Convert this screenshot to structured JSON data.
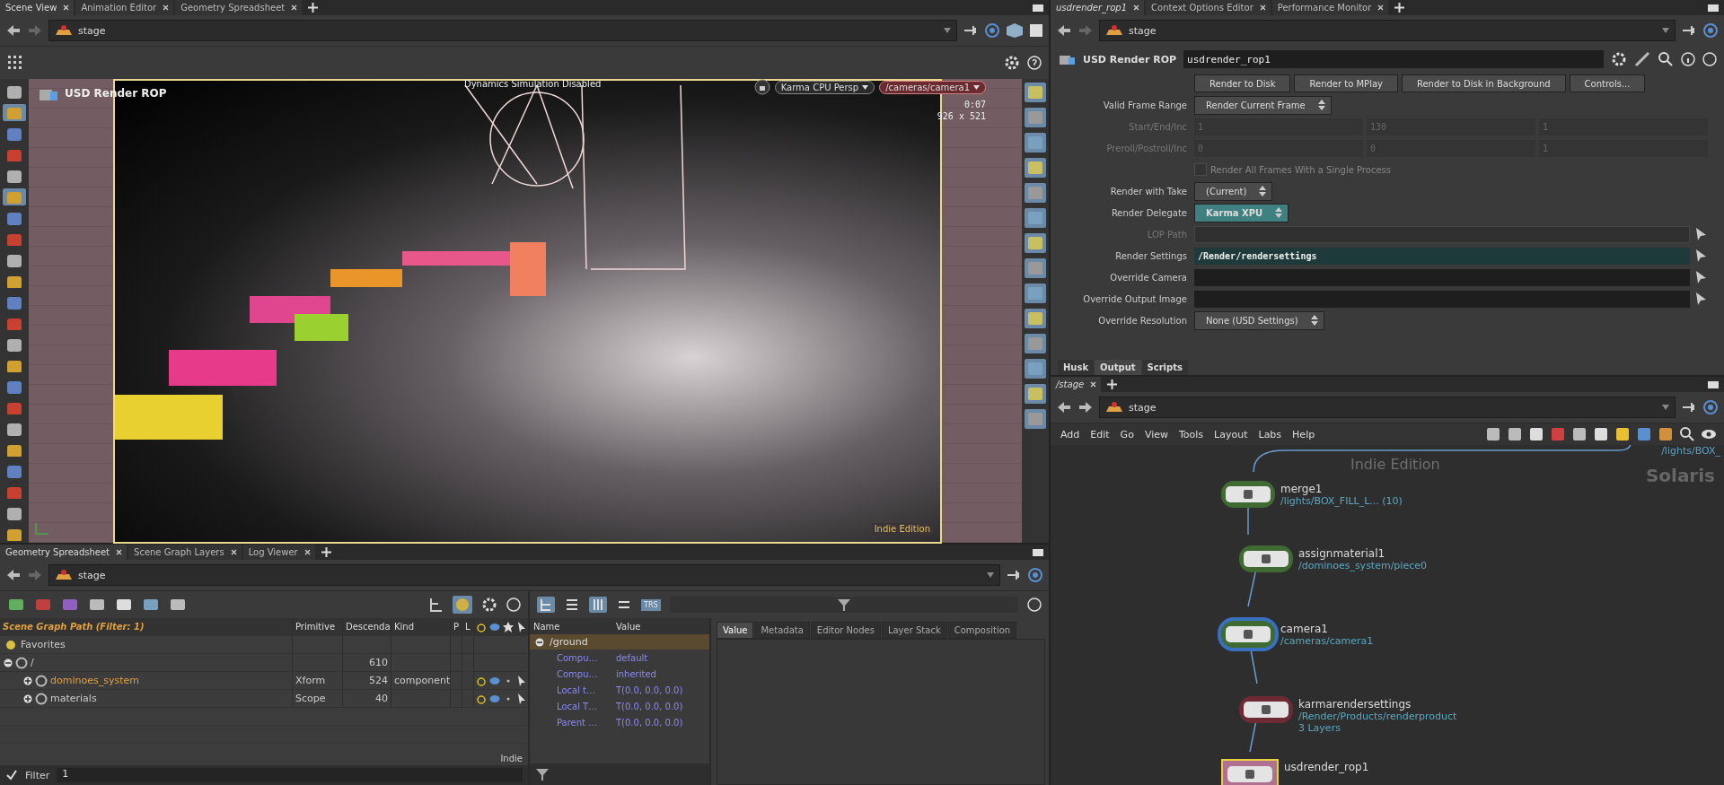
{
  "scene_view": {
    "tabs": [
      {
        "label": "Scene View",
        "selected": true
      },
      {
        "label": "Animation Editor",
        "selected": false
      },
      {
        "label": "Geometry Spreadsheet",
        "selected": false
      }
    ],
    "path": "stage",
    "viewport": {
      "node_label": "USD Render ROP",
      "status": "Dynamics Simulation Disabled",
      "renderer": "Karma CPU  Persp",
      "camera": "/cameras/camera1",
      "time": "0:07",
      "resolution": "926 x 521",
      "edition": "Indie Edition"
    }
  },
  "spreadsheet": {
    "tabs": [
      {
        "label": "Geometry Spreadsheet",
        "selected": true
      },
      {
        "label": "Scene Graph Layers",
        "selected": false
      },
      {
        "label": "Log Viewer",
        "selected": false
      }
    ],
    "path": "stage",
    "tree_columns": [
      "Scene Graph Path  (Filter: 1)",
      "Primitive",
      "Descenda",
      "Kind",
      "P",
      "L"
    ],
    "tree": [
      {
        "kind": "favorites",
        "name": "Favorites"
      },
      {
        "kind": "prim",
        "name": "/",
        "expanded": true,
        "highlighted": false,
        "descendants": "610",
        "children": [
          {
            "kind": "prim",
            "name": "dominoes_system",
            "expanded": false,
            "highlighted": true,
            "primitive": "Xform",
            "descendants": "524",
            "prim_kind": "component"
          },
          {
            "kind": "prim",
            "name": "materials",
            "expanded": false,
            "highlighted": false,
            "primitive": "Scope",
            "descendants": "40"
          }
        ]
      }
    ],
    "edition": "Indie",
    "filter_label": "Filter",
    "filter_value": "1",
    "attr_columns": [
      "Name",
      "Value"
    ],
    "attr_prim": "/ground",
    "attributes": [
      {
        "name": "Compu…",
        "value": "default"
      },
      {
        "name": "Compu…",
        "value": "inherited"
      },
      {
        "name": "Local t…",
        "value": "T(0.0, 0.0, 0.0)"
      },
      {
        "name": "Local T…",
        "value": "T(0.0, 0.0, 0.0)"
      },
      {
        "name": "Parent …",
        "value": "T(0.0, 0.0, 0.0)"
      }
    ],
    "trs_label": "TRS",
    "detail_tabs": [
      {
        "label": "Value",
        "selected": true
      },
      {
        "label": "Metadata",
        "selected": false
      },
      {
        "label": "Editor Nodes",
        "selected": false
      },
      {
        "label": "Layer Stack",
        "selected": false
      },
      {
        "label": "Composition",
        "selected": false
      }
    ]
  },
  "parameters": {
    "tabs": [
      {
        "label": "usdrender_rop1",
        "selected": true
      },
      {
        "label": "Context Options Editor",
        "selected": false
      },
      {
        "label": "Performance Monitor",
        "selected": false
      }
    ],
    "path": "stage",
    "node_type": "USD Render ROP",
    "node_name": "usdrender_rop1",
    "buttons": [
      "Render to Disk",
      "Render to MPlay",
      "Render to Disk in Background",
      "Controls..."
    ],
    "rows": [
      {
        "kind": "menu",
        "label": "Valid Frame Range",
        "value": "Render Current Frame",
        "highlighted": false
      },
      {
        "kind": "triple",
        "label": "Start/End/Inc",
        "values": [
          "1",
          "130",
          "1"
        ],
        "disabled": true
      },
      {
        "kind": "triple",
        "label": "Preroll/Postroll/Inc",
        "values": [
          "0",
          "0",
          "1"
        ],
        "disabled": true
      },
      {
        "kind": "checkbox",
        "text": "Render All Frames With a Single Process",
        "checked": false,
        "disabled": true
      },
      {
        "kind": "menu",
        "label": "Render with Take",
        "value": "(Current)",
        "highlighted": false
      },
      {
        "kind": "menu",
        "label": "Render Delegate",
        "value": "Karma XPU",
        "highlighted": true
      },
      {
        "kind": "path",
        "label": "LOP Path",
        "disabled": true,
        "highlighted": false
      },
      {
        "kind": "path",
        "label": "Render Settings",
        "value": "/Render/rendersettings",
        "disabled": false,
        "highlighted": true
      },
      {
        "kind": "path",
        "label": "Override Camera",
        "disabled": false,
        "highlighted": false
      },
      {
        "kind": "path",
        "label": "Override Output Image",
        "disabled": false,
        "highlighted": false
      },
      {
        "kind": "menu",
        "label": "Override Resolution",
        "value": "None (USD Settings)",
        "highlighted": false
      }
    ],
    "folder_tabs": [
      {
        "label": "Husk",
        "selected": false
      },
      {
        "label": "Output",
        "selected": true
      },
      {
        "label": "Scripts",
        "selected": false
      }
    ]
  },
  "network": {
    "tabs": [
      {
        "label": "/stage",
        "selected": true
      }
    ],
    "path": "stage",
    "menu": [
      "Add",
      "Edit",
      "Go",
      "View",
      "Tools",
      "Layout",
      "Labs",
      "Help"
    ],
    "edition": "Indie Edition",
    "context": "Solaris",
    "offscreen_path": "/lights/BOX_",
    "nodes": [
      {
        "name": "merge1",
        "info": [
          "/lights/BOX_FILL_L... (10)"
        ],
        "color": "#3f6a32",
        "selected": false,
        "display": false
      },
      {
        "name": "assignmaterial1",
        "info": [
          "/dominoes_system/piece0"
        ],
        "color": "#3f6a32",
        "selected": false,
        "display": false
      },
      {
        "name": "camera1",
        "info": [
          "/cameras/camera1"
        ],
        "color": "#3f6a32",
        "selected": true,
        "display": false
      },
      {
        "name": "karmarendersettings",
        "info": [
          "/Render/Products/renderproduct",
          "3 Layers"
        ],
        "color": "#6e2a34",
        "selected": false,
        "display": false
      },
      {
        "name": "usdrender_rop1",
        "color": "#b0708f",
        "selected": false,
        "display": true
      }
    ]
  }
}
